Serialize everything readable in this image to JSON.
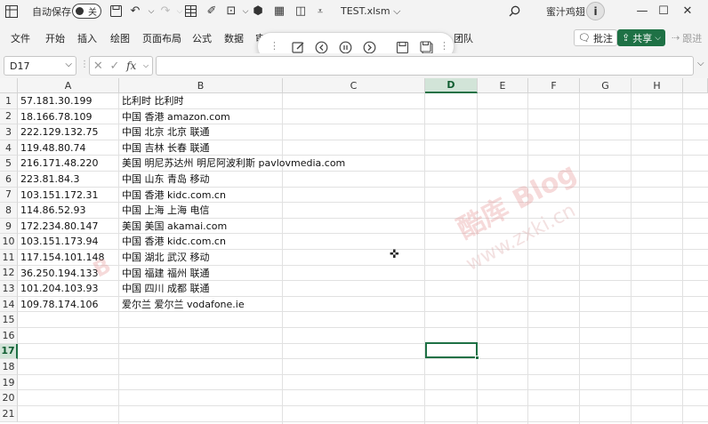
{
  "titlebar": {
    "autosave_label": "自动保存",
    "autosave_state": "关",
    "doc_title": "TEST.xlsm ⌵",
    "user_name": "蜜汁鸡翅",
    "avatar_initial": "i"
  },
  "ribbon": {
    "tabs": [
      "文件",
      "开始",
      "插入",
      "绘图",
      "页面布局",
      "公式",
      "数据",
      "审",
      "团队"
    ],
    "comment_label": "批注",
    "share_label": "共享",
    "follow_label": "跟进"
  },
  "formula_bar": {
    "name_box": "D17",
    "fx": "fx",
    "formula_value": ""
  },
  "grid": {
    "columns": [
      "A",
      "B",
      "C",
      "D",
      "E",
      "F",
      "G",
      "H"
    ],
    "active_column": "D",
    "rows": [
      "1",
      "2",
      "3",
      "4",
      "5",
      "6",
      "7",
      "8",
      "9",
      "10",
      "11",
      "12",
      "13",
      "14",
      "15",
      "16",
      "17",
      "18",
      "19",
      "20",
      "21"
    ],
    "active_row": "17",
    "data": [
      [
        "57.181.30.199",
        "比利时 比利时"
      ],
      [
        "18.166.78.109",
        "中国 香港  amazon.com"
      ],
      [
        "222.129.132.75",
        "中国 北京 北京 联通"
      ],
      [
        "119.48.80.74",
        "中国 吉林 长春 联通"
      ],
      [
        "216.171.48.220",
        "美国 明尼苏达州 明尼阿波利斯 pavlovmedia.com"
      ],
      [
        "223.81.84.3",
        "中国 山东 青岛 移动"
      ],
      [
        "103.151.172.31",
        "中国 香港  kidc.com.cn"
      ],
      [
        "114.86.52.93",
        "中国 上海 上海 电信"
      ],
      [
        "172.234.80.147",
        "美国 美国  akamai.com"
      ],
      [
        "103.151.173.94",
        "中国 香港  kidc.com.cn"
      ],
      [
        "117.154.101.148",
        "中国 湖北 武汉 移动"
      ],
      [
        "36.250.194.133",
        "中国 福建 福州 联通"
      ],
      [
        "101.204.103.93",
        "中国 四川 成都 联通"
      ],
      [
        "109.78.174.106",
        "爱尔兰 爱尔兰  vodafone.ie"
      ]
    ]
  },
  "watermark": {
    "big": "酷库 Blog",
    "small": "www.zxki.cn"
  },
  "colors": {
    "accent": "#1e7145",
    "header_bg": "#f5f5f5",
    "active_header_bg": "#d2e4d8"
  }
}
